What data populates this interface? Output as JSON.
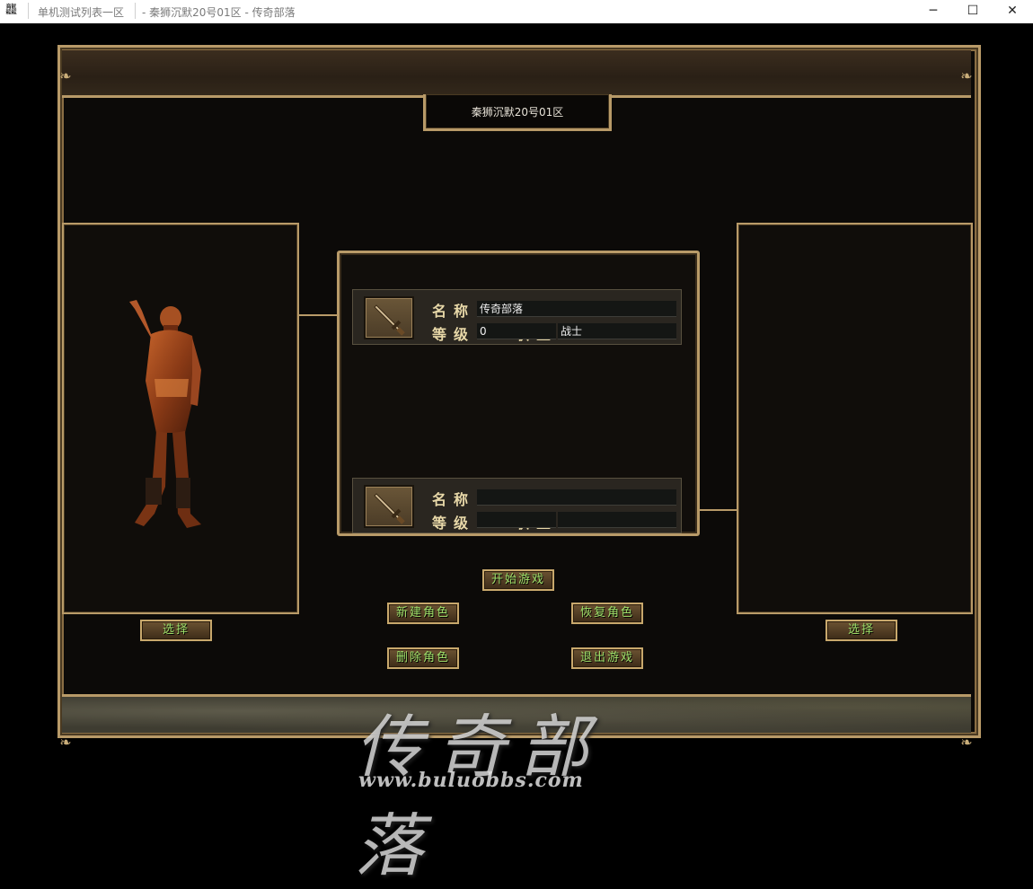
{
  "window": {
    "tab1": "单机测试列表一区",
    "title": "- 秦狮沉默20号01区 - 传奇部落",
    "minimize_icon": "minimize-icon",
    "maximize_icon": "maximize-icon",
    "close_icon": "close-icon"
  },
  "server_name": "秦狮沉默20号01区",
  "slots": [
    {
      "name_label": "名称",
      "level_label": "等级",
      "class_label": "职业",
      "name": "传奇部落",
      "level": "0",
      "class": "战士",
      "icon": "sword-icon"
    },
    {
      "name_label": "名称",
      "level_label": "等级",
      "class_label": "职业",
      "name": "",
      "level": "",
      "class": "",
      "icon": "sword-icon"
    }
  ],
  "buttons": {
    "start": "开始游戏",
    "new_char": "新建角色",
    "restore_char": "恢复角色",
    "delete_char": "删除角色",
    "exit_game": "退出游戏",
    "select_left": "选择",
    "select_right": "选择"
  },
  "watermark": {
    "text": "传奇部落",
    "url": "www.buluobbs.com"
  },
  "colors": {
    "frame_gold": "#b89a68",
    "button_text": "#9fe06a",
    "label_text": "#e8d8a8"
  }
}
